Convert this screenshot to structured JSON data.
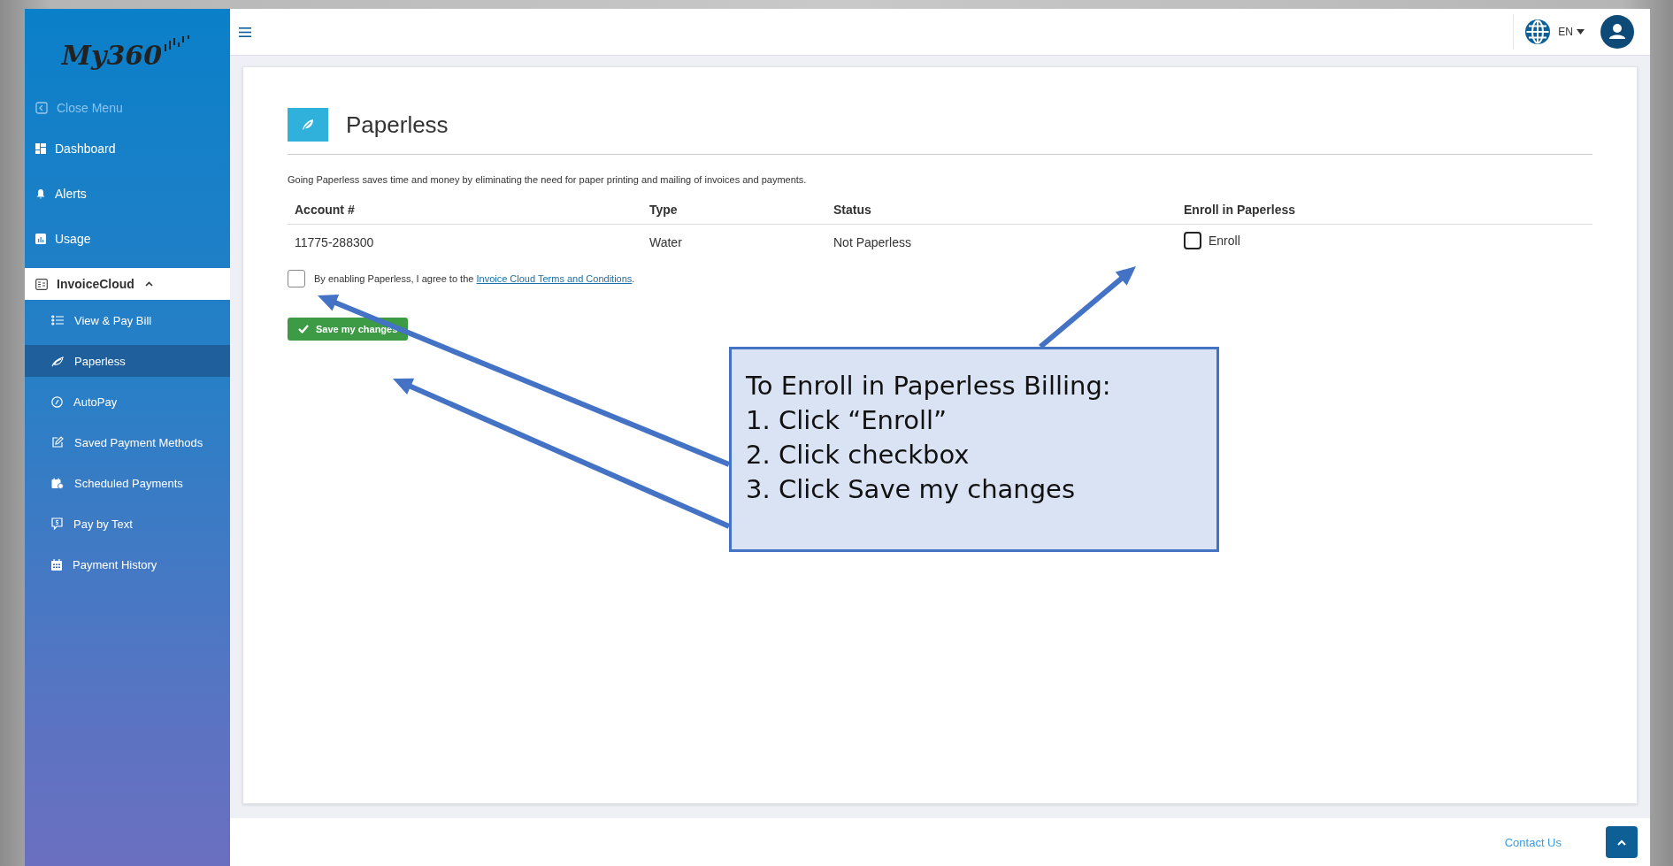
{
  "sidebar": {
    "logo": "My360",
    "items": [
      {
        "kind": "close",
        "label": "Close Menu",
        "selected": false
      },
      {
        "kind": "link",
        "label": "Dashboard",
        "selected": false
      },
      {
        "kind": "link",
        "label": "Alerts",
        "selected": false
      },
      {
        "kind": "link",
        "label": "Usage",
        "selected": false
      },
      {
        "kind": "section",
        "label": "InvoiceCloud",
        "expanded": true,
        "children": [
          {
            "label": "View & Pay Bill",
            "selected": false
          },
          {
            "label": "Paperless",
            "selected": true
          },
          {
            "label": "AutoPay",
            "selected": false
          },
          {
            "label": "Saved Payment Methods",
            "selected": false
          },
          {
            "label": "Scheduled Payments",
            "selected": false
          },
          {
            "label": "Pay by Text",
            "selected": false
          },
          {
            "label": "Payment History",
            "selected": false
          }
        ]
      }
    ]
  },
  "header": {
    "language": "EN"
  },
  "page": {
    "title": "Paperless",
    "description": "Going Paperless saves time and money by eliminating the need for paper printing and mailing of invoices and payments.",
    "table": {
      "columns": [
        "Account #",
        "Type",
        "Status",
        "Enroll in Paperless"
      ],
      "rows": [
        {
          "account": "11775-288300",
          "type": "Water",
          "status": "Not Paperless",
          "enroll_label": "Enroll",
          "checked": false
        }
      ]
    },
    "agreement": {
      "text": "By enabling Paperless, I agree to the ",
      "link": "Invoice Cloud Terms and Conditions",
      "end": ".",
      "checked": false
    },
    "save_button": "Save my changes"
  },
  "callout": {
    "lines": [
      "To Enroll in Paperless Billing:",
      "1. Click “Enroll”",
      "2. Click checkbox",
      "3. Click Save my changes"
    ]
  },
  "footer": {
    "contact": "Contact Us"
  }
}
